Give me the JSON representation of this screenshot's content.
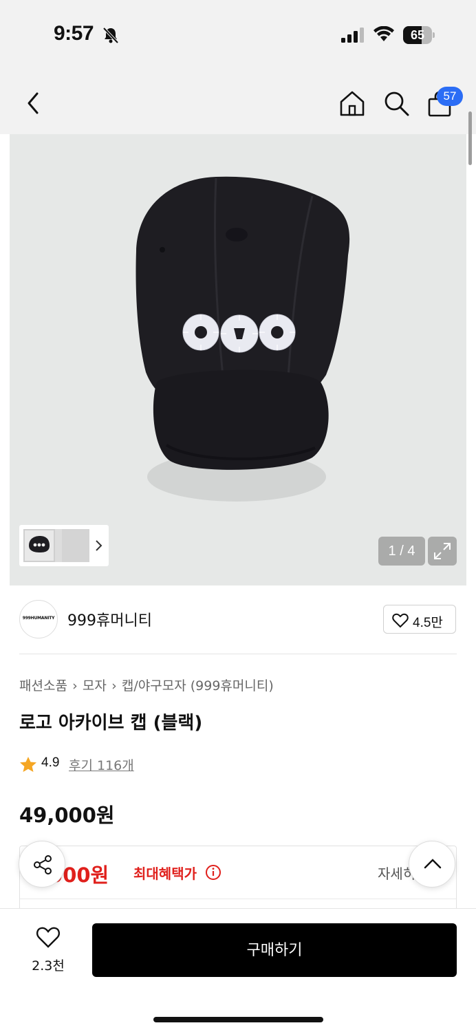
{
  "status_bar": {
    "time": "9:57",
    "battery": "65",
    "battery_level": 0.65
  },
  "nav": {
    "cart_count": "57"
  },
  "gallery": {
    "counter": "1 / 4",
    "total_images": 4
  },
  "brand": {
    "logo_text": "999HUMANITY",
    "name": "999휴머니티",
    "likes": "4.5만"
  },
  "breadcrumb": [
    "패션소품",
    "모자",
    "캡/야구모자 (999휴머니티)"
  ],
  "product": {
    "title": "로고 아카이브 캡 (블랙)",
    "rating": "4.9",
    "reviews": "후기 116개",
    "price": "49,000원"
  },
  "benefit": {
    "price": ",000원",
    "label": "최대혜택가",
    "detail": "자세히"
  },
  "bottom": {
    "wish_count": "2.3천",
    "buy_label": "구매하기"
  },
  "colors": {
    "accent_blue": "#2b6df5",
    "benefit_red": "#e0201c",
    "star": "#f5a623"
  }
}
